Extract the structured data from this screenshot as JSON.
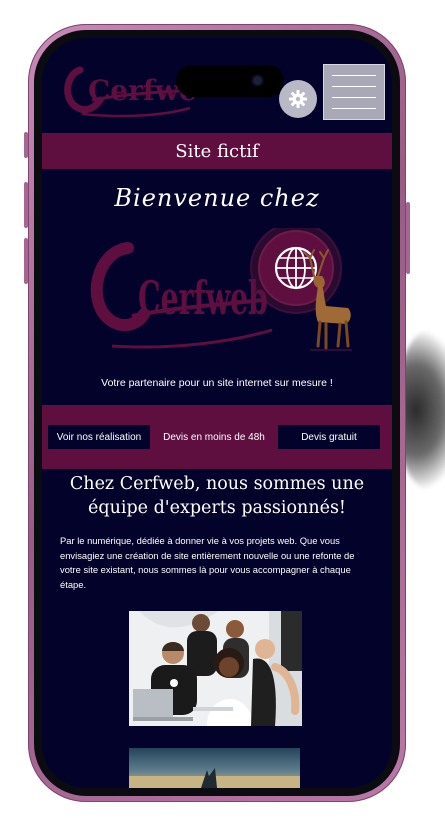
{
  "header": {
    "logo_text": "Cerfweb",
    "settings_icon": "gear-icon",
    "menu_icon": "hamburger-menu-icon"
  },
  "banner": {
    "title": "Site fictif"
  },
  "hero": {
    "welcome": "Bienvenue chez",
    "logo_text": "Cerfweb",
    "logo_icons": [
      "globe-icon",
      "deer-icon"
    ],
    "tagline": "Votre partenaire pour un site internet sur mesure !"
  },
  "cta": [
    {
      "label": "Voir nos réalisation"
    },
    {
      "label": "Devis en moins de 48h"
    },
    {
      "label": "Devis gratuit"
    }
  ],
  "about": {
    "headline": "Chez Cerfweb, nous sommes une équipe d'experts passionnés!",
    "intro": "Par le numérique, dédiée à donner vie à vos projets web. Que vous envisagiez une création de site entièrement nouvelle ou une refonte de votre site existant, nous sommes là pour vous accompagner à chaque étape."
  },
  "colors": {
    "page_bg": "#03022a",
    "accent": "#5e0f3f",
    "phone_frame": "#b978a6",
    "logo_text": "#5e0f3f"
  }
}
